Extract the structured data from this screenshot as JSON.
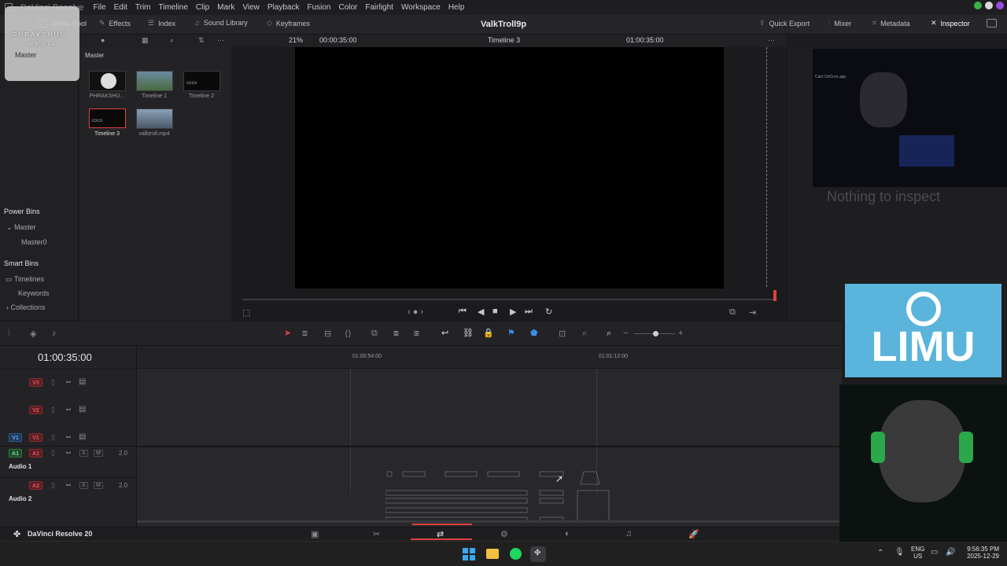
{
  "menubar": {
    "app_name": "DaVinci Resolve",
    "items": [
      "File",
      "Edit",
      "Trim",
      "Timeline",
      "Clip",
      "Mark",
      "View",
      "Playback",
      "Fusion",
      "Color",
      "Fairlight",
      "Workspace",
      "Help"
    ]
  },
  "toolbar": {
    "media_pool": "Media Pool",
    "effects": "Effects",
    "index": "Index",
    "sound_library": "Sound Library",
    "keyframes": "Keyframes",
    "project_title": "ValkTroll9p",
    "quick_export": "Quick Export",
    "mixer": "Mixer",
    "metadata": "Metadata",
    "inspector": "Inspector"
  },
  "viewer": {
    "zoom": "21%",
    "timecode_left": "00:00:35:00",
    "timeline_name": "Timeline 3",
    "timecode_right": "01:00:35:00"
  },
  "media_pool": {
    "bin_title": "Master",
    "clips": [
      {
        "label": "PHRAKSHU..."
      },
      {
        "label": "Timeline 1"
      },
      {
        "label": "Timeline 2"
      },
      {
        "label": "Timeline 3"
      },
      {
        "label": "valktroll.mp4"
      }
    ]
  },
  "sidebar": {
    "master": "Master",
    "power_bins_title": "Power Bins",
    "power_bins": [
      "Master",
      "Master0"
    ],
    "smart_bins_title": "Smart Bins",
    "smart_bins": [
      "Timelines",
      "Keywords",
      "Collections"
    ]
  },
  "inspector": {
    "empty_text": "Nothing to inspect"
  },
  "timeline": {
    "timecode": "01:00:35:00",
    "ruler": [
      "01:00:54:00",
      "01:01:12:00"
    ],
    "tracks": [
      {
        "tag": "V3"
      },
      {
        "tag": "V2"
      },
      {
        "tag": "V1",
        "src": "V1"
      },
      {
        "tag": "A1",
        "src": "A1",
        "level": "2.0",
        "name": "Audio 1"
      },
      {
        "tag": "A2",
        "level": "2.0",
        "name": "Audio 2"
      }
    ],
    "solo": "S",
    "mute": "M"
  },
  "footer": {
    "brand": "DaVinci Resolve 20"
  },
  "overlays": {
    "logo_line1": "PHRAKSHUN",
    "logo_line2": "MEDIA",
    "webcam_text": "Cam OriCron.app",
    "limu": "LIMU"
  },
  "taskbar": {
    "lang1": "ENG",
    "lang2": "US",
    "time": "9:56:35 PM",
    "date": "2025-12-29"
  },
  "colors": {
    "accent_red": "#e04040",
    "accent_blue": "#3a8ee8",
    "limu_blue": "#5ab4dc"
  }
}
